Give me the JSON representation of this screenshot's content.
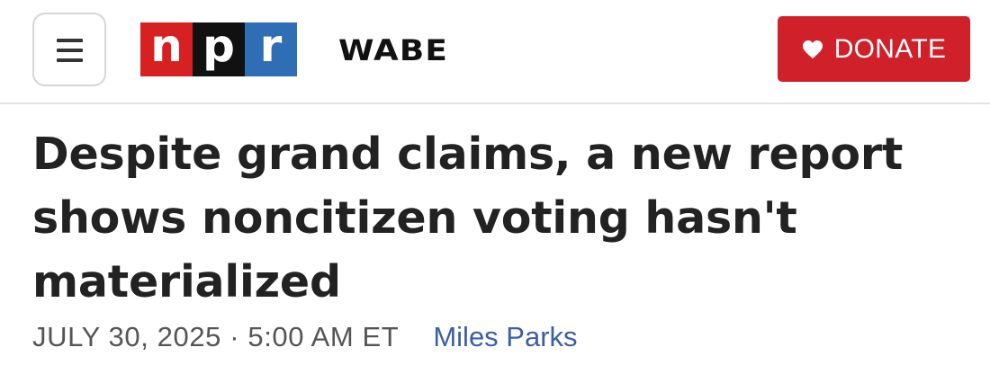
{
  "header": {
    "menu_icon": "hamburger-menu-icon",
    "npr_logo": {
      "letters": [
        "n",
        "p",
        "r"
      ],
      "colors": [
        "#d62021",
        "#111111",
        "#2f6db5"
      ]
    },
    "station_logo": "WABE",
    "donate": {
      "icon": "heart-icon",
      "label": "DONATE",
      "background": "#d0202a"
    }
  },
  "article": {
    "headline": "Despite grand claims, a new report shows noncitizen voting hasn't materialized",
    "dateline": "JULY 30, 2025 · 5:00 AM ET",
    "author": "Miles Parks"
  }
}
